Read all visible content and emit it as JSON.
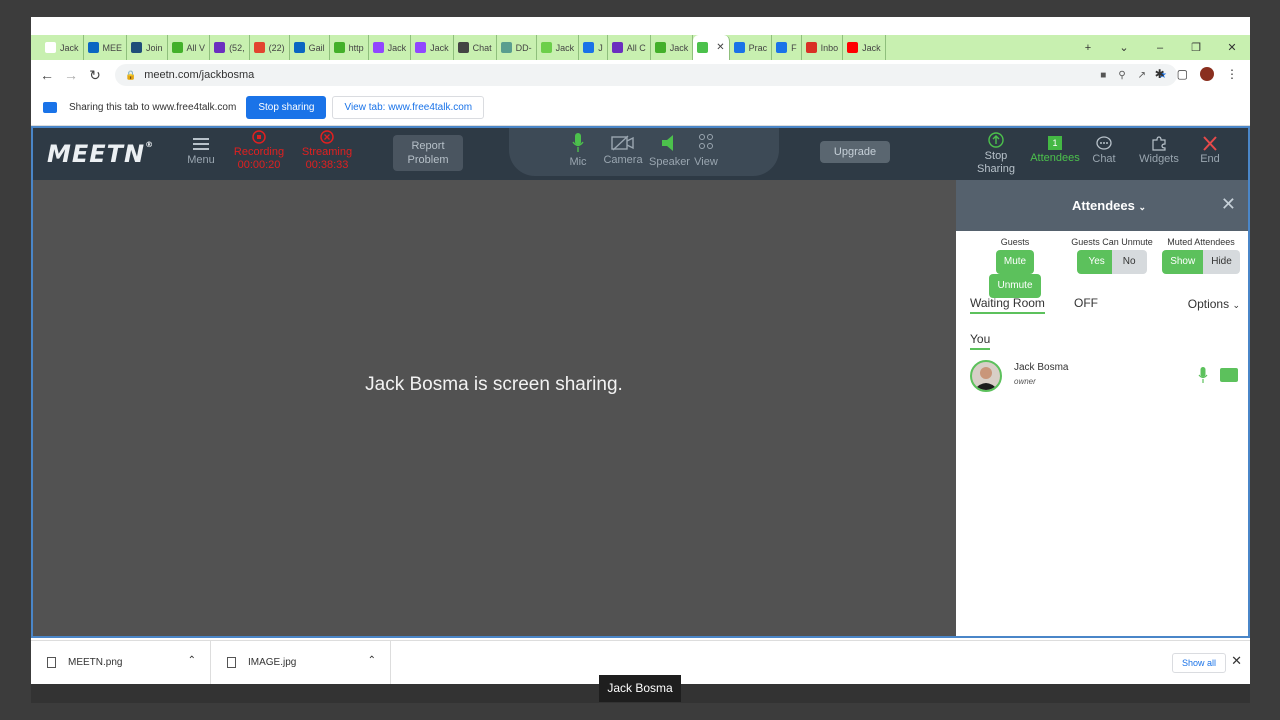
{
  "browser": {
    "tabs": [
      {
        "label": "Jack",
        "fav_color": "#ffffff"
      },
      {
        "label": "MEE",
        "fav_color": "#0a66c2"
      },
      {
        "label": "Join",
        "fav_color": "#1f4e79"
      },
      {
        "label": "All V",
        "fav_color": "#43b02a"
      },
      {
        "label": "(52,",
        "fav_color": "#6b2fbf"
      },
      {
        "label": "(22)",
        "fav_color": "#e2442f"
      },
      {
        "label": "Gail",
        "fav_color": "#0a66c2"
      },
      {
        "label": "http",
        "fav_color": "#43b02a"
      },
      {
        "label": "Jack",
        "fav_color": "#9146ff"
      },
      {
        "label": "Jack",
        "fav_color": "#9146ff"
      },
      {
        "label": "Chat",
        "fav_color": "#444444"
      },
      {
        "label": "DD-",
        "fav_color": "#5a9e8f"
      },
      {
        "label": "Jack",
        "fav_color": "#6ccf4a"
      },
      {
        "label": "J",
        "fav_color": "#1a73e8"
      },
      {
        "label": "All C",
        "fav_color": "#6b2fbf"
      },
      {
        "label": "Jack",
        "fav_color": "#43b02a"
      },
      {
        "label": "",
        "fav_color": "#4cc14c",
        "active": true
      },
      {
        "label": "Prac",
        "fav_color": "#1a73e8"
      },
      {
        "label": "F",
        "fav_color": "#1a73e8"
      },
      {
        "label": "Inbo",
        "fav_color": "#d93025"
      },
      {
        "label": "Jack",
        "fav_color": "#ff0000"
      }
    ],
    "new_tab": "+",
    "window_controls": [
      "⌄",
      "–",
      "❐",
      "✕"
    ],
    "url": "meetn.com/jackbosma"
  },
  "sharing_bar": {
    "text": "Sharing this tab to www.free4talk.com",
    "stop_label": "Stop sharing",
    "view_label": "View tab: www.free4talk.com"
  },
  "meetn": {
    "logo": "MEETN",
    "logo_mark": "®",
    "menu_label": "Menu",
    "recording_label": "Recording",
    "recording_time": "00:00:20",
    "streaming_label": "Streaming",
    "streaming_time": "00:38:33",
    "report_line1": "Report",
    "report_line2": "Problem",
    "mic_label": "Mic",
    "camera_label": "Camera",
    "speaker_label": "Speaker",
    "view_label": "View",
    "upgrade_label": "Upgrade",
    "stop_sharing_line1": "Stop",
    "stop_sharing_line2": "Sharing",
    "attendees_label": "Attendees",
    "attendees_count": "1",
    "chat_label": "Chat",
    "widgets_label": "Widgets",
    "end_label": "End",
    "stage_message": "Jack Bosma is screen sharing."
  },
  "sidebar": {
    "title": "Attendees",
    "guests_label": "Guests",
    "mute_label": "Mute",
    "unmute_label": "Unmute",
    "can_unmute_label": "Guests Can Unmute",
    "yes_label": "Yes",
    "no_label": "No",
    "muted_label": "Muted Attendees",
    "show_label": "Show",
    "hide_label": "Hide",
    "waiting_room_label": "Waiting Room",
    "waiting_room_state": "OFF",
    "options_label": "Options",
    "you_label": "You",
    "attendee_name": "Jack Bosma",
    "attendee_role": "owner"
  },
  "downloads": {
    "file1": "MEETN.png",
    "file2": "IMAGE.jpg",
    "show_all": "Show all"
  },
  "caption": "Jack Bosma",
  "colors": {
    "accent_green": "#5cc15c",
    "alert_red": "#e02020",
    "chrome_blue": "#1a73e8",
    "tabstrip_green": "#c8f0b0"
  }
}
